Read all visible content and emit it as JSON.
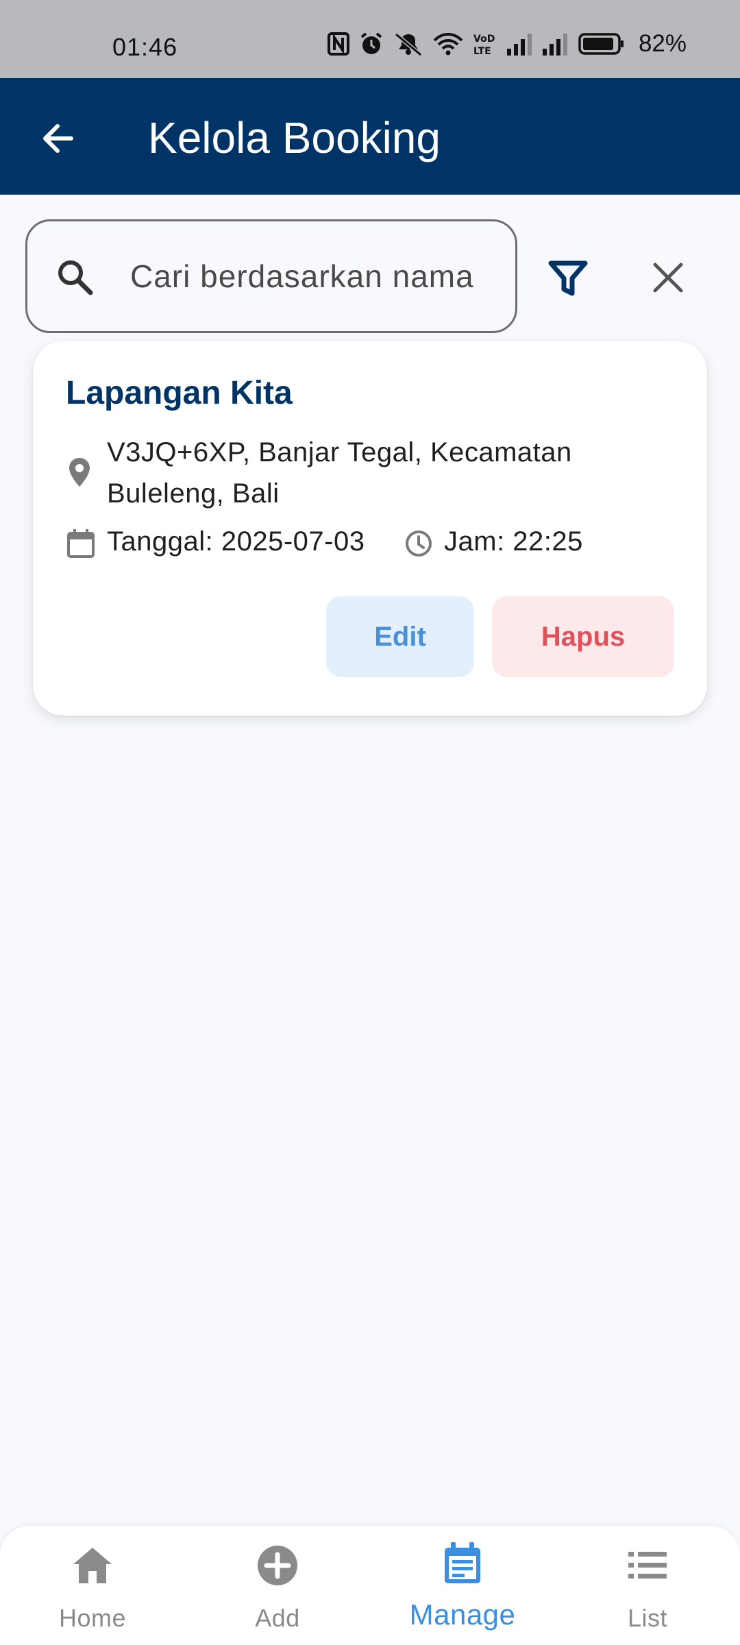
{
  "status_bar": {
    "time": "01:46",
    "battery_percent": "82%",
    "icons": [
      "nfc-icon",
      "alarm-icon",
      "mute-icon",
      "wifi-icon",
      "volte-icon",
      "signal-icon",
      "signal-icon",
      "battery-icon"
    ]
  },
  "app_bar": {
    "title": "Kelola Booking",
    "back_icon": "arrow-back-icon"
  },
  "search": {
    "placeholder": "Cari berdasarkan nama",
    "value": ""
  },
  "colors": {
    "primary": "#003366",
    "accent": "#3b8ee0",
    "edit_bg": "#e3f0fb",
    "edit_text": "#4a90d9",
    "delete_bg": "#fde8ea",
    "delete_text": "#e0515a"
  },
  "bookings": [
    {
      "name": "Lapangan Kita",
      "address": "V3JQ+6XP, Banjar Tegal, Kecamatan Buleleng, Bali",
      "date": "Tanggal: 2025-07-03",
      "time": "Jam: 22:25",
      "edit_label": "Edit",
      "delete_label": "Hapus"
    }
  ],
  "bottom_nav": {
    "items": [
      {
        "label": "Home",
        "icon": "home-icon",
        "active": false
      },
      {
        "label": "Add",
        "icon": "add-circle-icon",
        "active": false
      },
      {
        "label": "Manage",
        "icon": "event-note-icon",
        "active": true
      },
      {
        "label": "List",
        "icon": "list-icon",
        "active": false
      }
    ]
  }
}
